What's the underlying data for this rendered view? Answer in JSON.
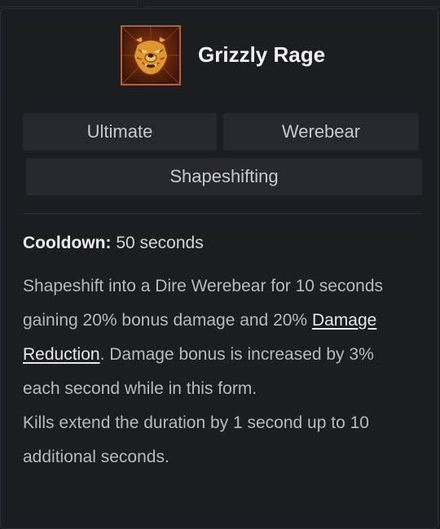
{
  "skill": {
    "name": "Grizzly Rage",
    "icon": "bear-head-icon",
    "tags": [
      "Ultimate",
      "Werebear",
      "Shapeshifting"
    ]
  },
  "cooldown": {
    "label": "Cooldown:",
    "value": "50 seconds"
  },
  "description": {
    "line1_pre": "Shapeshift into a Dire Werebear for 10 seconds gaining 20% bonus damage and 20% ",
    "link_text": "Damage Reduction",
    "line1_post": ". Damage bonus is increased by 3% each second while in this form.",
    "line2": "Kills extend the duration by 1 second up to 10 additional seconds."
  },
  "colors": {
    "background": "#1c1d21",
    "tag_background": "#27282d",
    "title": "#f2f2f2",
    "text": "#b9b9b9",
    "icon_border": "#b8612d",
    "icon_gold": "#e8a23a"
  }
}
